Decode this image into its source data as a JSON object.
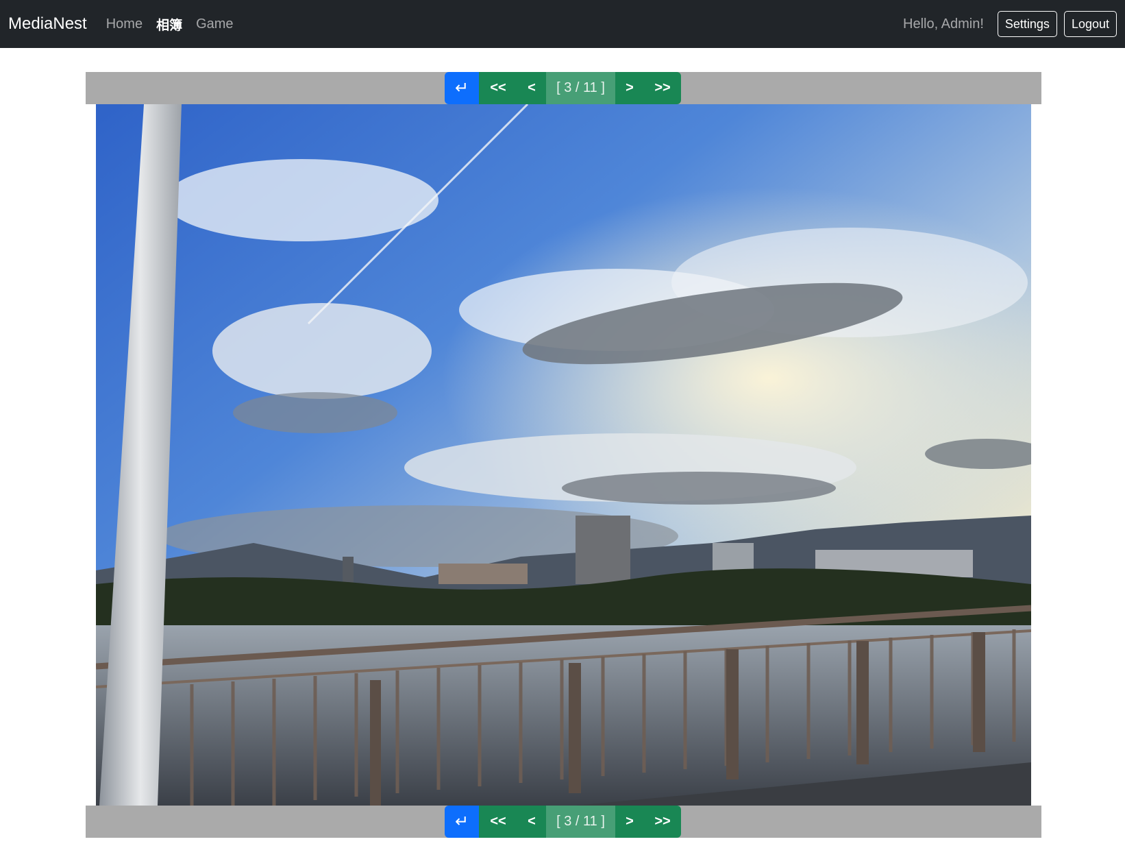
{
  "navbar": {
    "brand": "MediaNest",
    "links": [
      {
        "label": "Home"
      },
      {
        "label": "相簿"
      },
      {
        "label": "Game"
      }
    ],
    "greeting": "Hello, Admin!",
    "settings_label": "Settings",
    "logout_label": "Logout"
  },
  "pager": {
    "back_icon": "↵",
    "first_label": "<<",
    "prev_label": "<",
    "counter": "[ 3 / 11 ]",
    "next_label": ">",
    "last_label": ">>"
  },
  "photo": {
    "description_icon": "landscape-photo",
    "current": 3,
    "total": 11
  },
  "colors": {
    "navbar_bg": "#212529",
    "back_button": "#0d6efd",
    "nav_button": "#198754",
    "counter_button": "#479f76",
    "pager_bar": "#aaaaaa"
  }
}
